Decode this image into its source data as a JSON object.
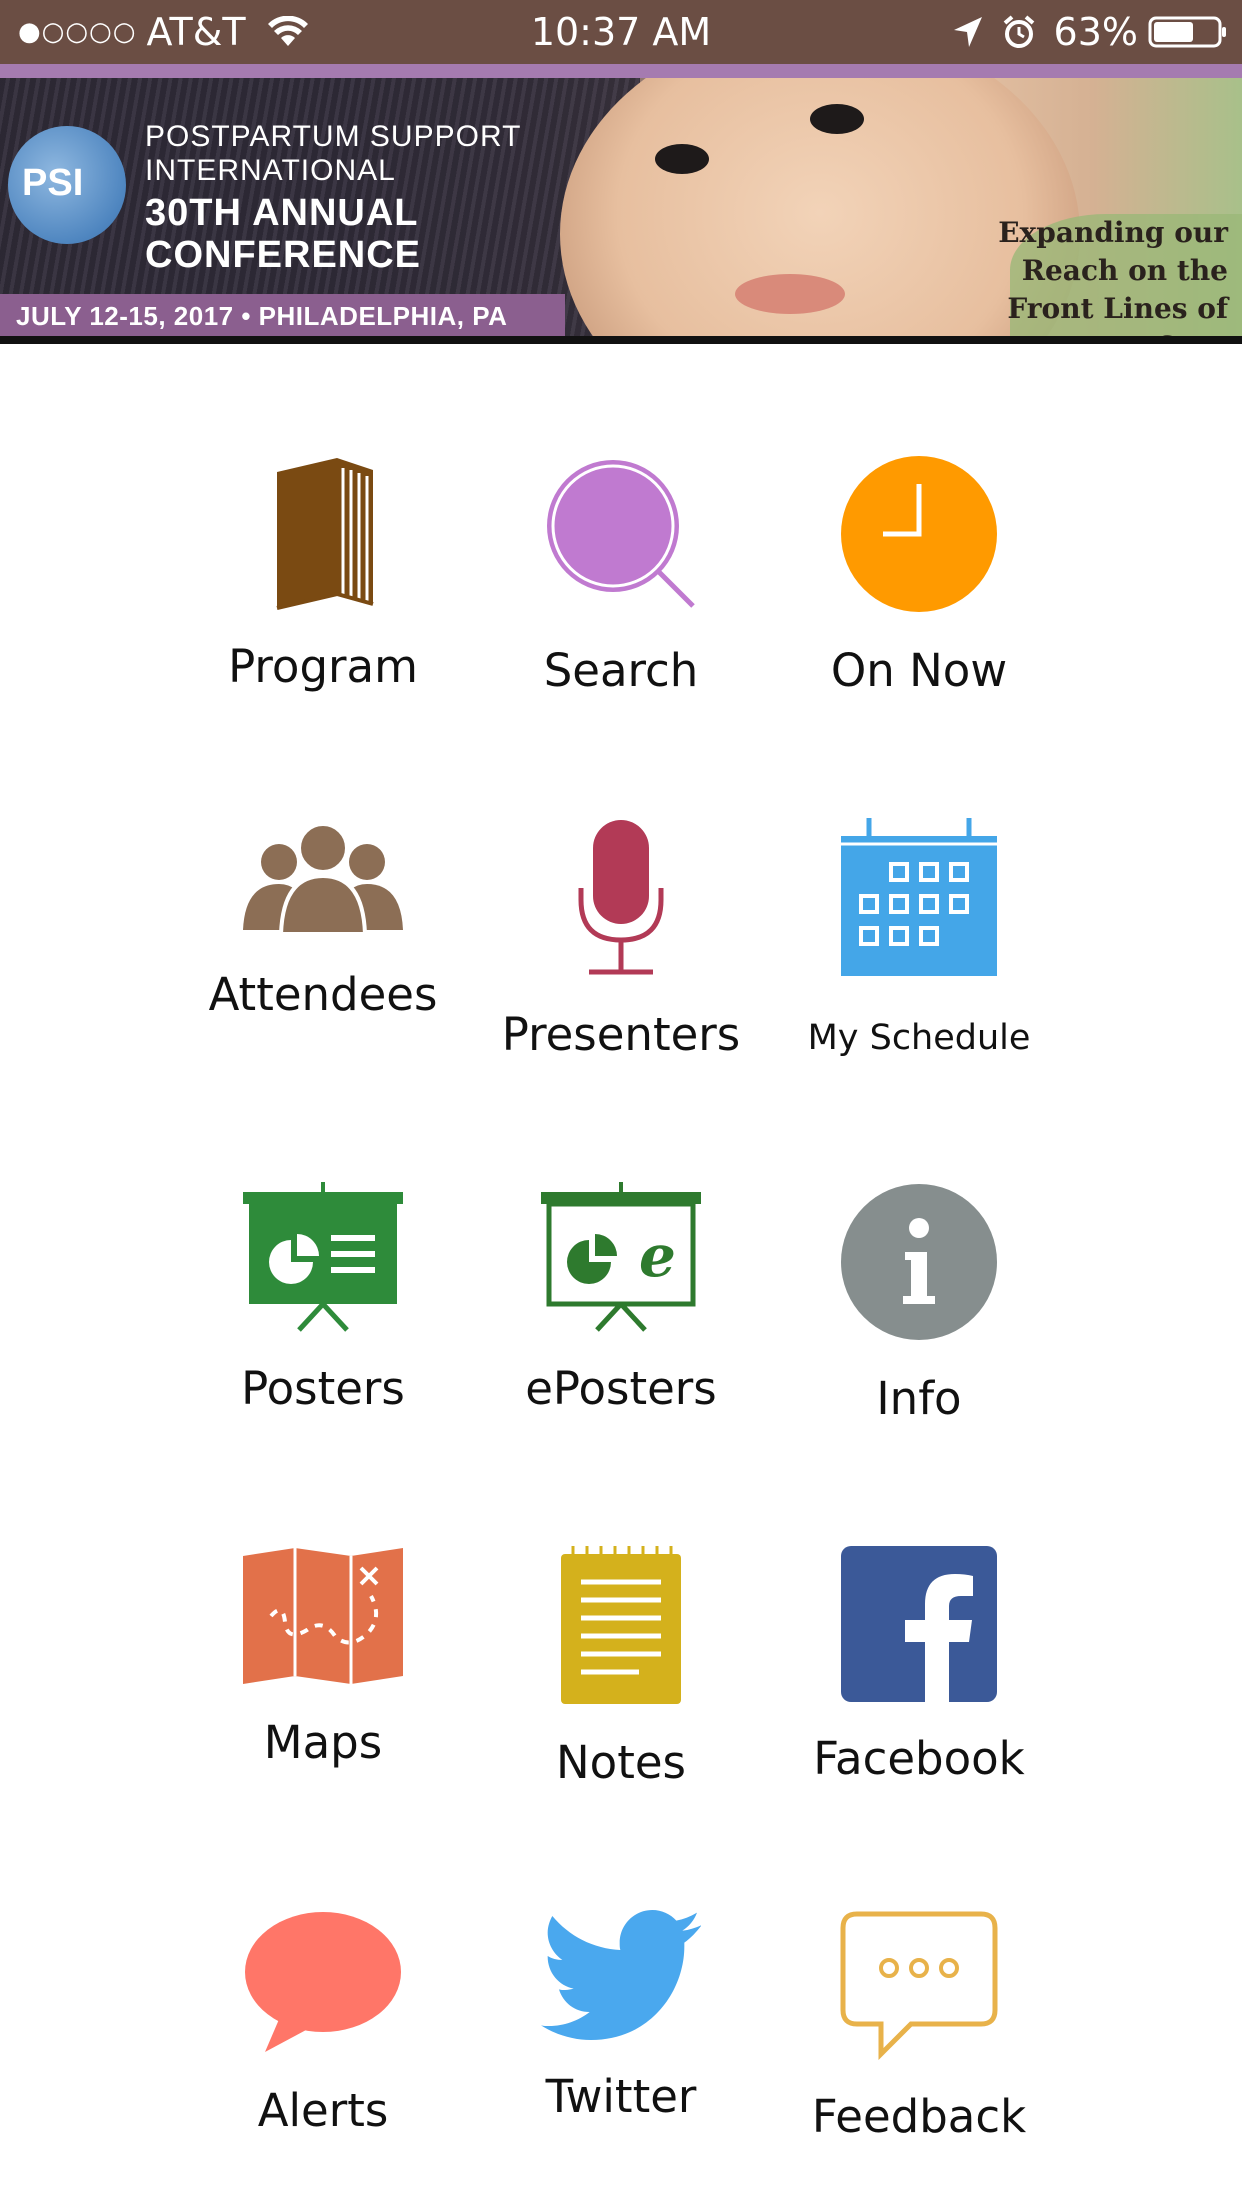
{
  "status_bar": {
    "signal": "●○○○○",
    "carrier": "AT&T",
    "time": "10:37 AM",
    "battery_percent": "63%",
    "battery_level": 0.63,
    "icons": [
      "wifi-icon",
      "location-arrow-icon",
      "alarm-icon",
      "battery-icon"
    ]
  },
  "banner": {
    "logo_text": "PSI",
    "org_line1": "POSTPARTUM SUPPORT",
    "org_line2": "INTERNATIONAL",
    "conference_line1": "30TH ANNUAL",
    "conference_line2": "CONFERENCE",
    "dateline": "JULY 12-15, 2017 • PHILADELPHIA, PA",
    "tagline_line1": "Expanding our",
    "tagline_line2": "Reach on the",
    "tagline_line3": "Front Lines of Care"
  },
  "menu": {
    "program": "Program",
    "search": "Search",
    "on_now": "On Now",
    "attendees": "Attendees",
    "presenters": "Presenters",
    "my_schedule": "My Schedule",
    "posters": "Posters",
    "eposters": "ePosters",
    "info": "Info",
    "maps": "Maps",
    "notes": "Notes",
    "facebook": "Facebook",
    "alerts": "Alerts",
    "twitter": "Twitter",
    "feedback": "Feedback"
  },
  "colors": {
    "status_bar_bg": "#6b4e44",
    "program": "#7a4a12",
    "search": "#c07ad0",
    "on_now": "#ff9a00",
    "attendees": "#8c6e55",
    "presenters": "#b23a56",
    "my_schedule": "#44a6e8",
    "posters": "#2e8b3a",
    "eposters": "#2e7a2e",
    "info": "#868e8e",
    "maps": "#e2714a",
    "notes": "#d4b11c",
    "facebook": "#3b5998",
    "alerts": "#ff7668",
    "twitter": "#4aa8ee",
    "feedback": "#e8b24a"
  }
}
